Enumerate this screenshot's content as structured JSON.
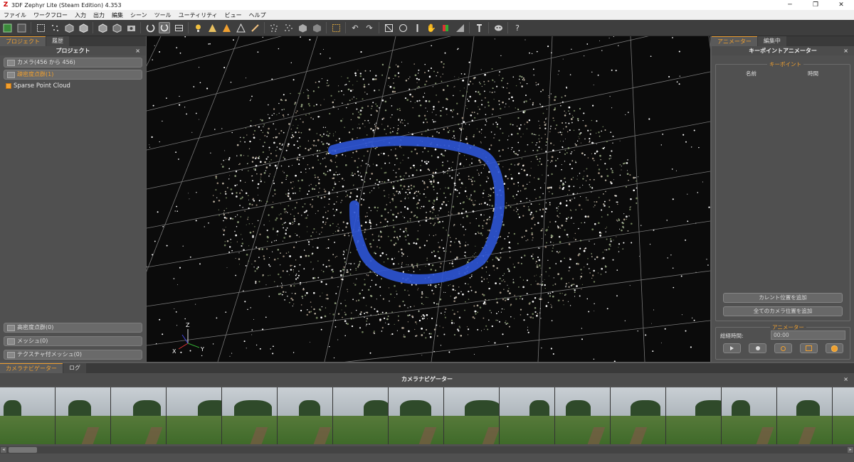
{
  "window": {
    "title": "3DF Zephyr Lite (Steam Edition) 4.353",
    "minimize_glyph": "─",
    "maximize_glyph": "❐",
    "close_glyph": "✕"
  },
  "menu": [
    "ファイル",
    "ワークフロー",
    "入力",
    "出力",
    "編集",
    "シーン",
    "ツール",
    "ユーティリティ",
    "ビュー",
    "ヘルプ"
  ],
  "toolbar": {
    "icons": [
      "import-icon",
      "save-icon",
      "select-rect-icon",
      "select-points-icon",
      "cube-icon",
      "cube-icon",
      "cube-icon",
      "cube-icon",
      "cube-icon",
      "camera-icon",
      "rotate-icon",
      "orbit-icon",
      "frame-icon",
      "light-icon",
      "mesh-triangle-icon",
      "mesh-triangle-icon",
      "mesh-triangle-icon",
      "brush-icon",
      "points-icon",
      "points-icon",
      "cube-icon",
      "cube-icon",
      "bounding-box-icon",
      "undo-icon",
      "redo-icon",
      "transform-icon",
      "circle-icon",
      "measure-icon",
      "hand-icon",
      "color-icon",
      "ruler-icon",
      "tool-icon",
      "mask-icon",
      "help-icon"
    ],
    "help_label": "?"
  },
  "left_panel": {
    "tabs": [
      "プロジェクト",
      "履歴"
    ],
    "header": "プロジェクト",
    "close": "×",
    "cameras": "カメラ(456 から 456)",
    "sparse_group": "疎密度点群(1)",
    "sparse_item": "Sparse Point Cloud",
    "dense_group": "高密度点群(0)",
    "mesh_group": "メッシュ(0)",
    "textured_group": "テクスチャ付メッシュ(0)"
  },
  "viewport": {
    "axis_labels": {
      "z": "Z",
      "x": "X",
      "y": "Y"
    }
  },
  "right_panel": {
    "tabs": [
      "アニメーター",
      "編集中"
    ],
    "header": "キーポイントアニメーター",
    "close": "×",
    "keypoint_box_label": "キーポイント",
    "col_name": "名前",
    "col_time": "時間",
    "add_current": "カレント位置を追加",
    "add_all_cameras": "全てのカメラ位置を追加",
    "animator_box_label": "アニメーター",
    "total_time_label": "総経時間:",
    "total_time_value": "00:00"
  },
  "bottom": {
    "tabs": [
      "カメラナビゲーター",
      "ログ"
    ],
    "header": "カメラナビゲーター",
    "close": "×"
  },
  "colors": {
    "accent": "#f0a030",
    "panel": "#505050",
    "viewport_bg": "#0b0b0b",
    "camera_path": "#2d55d6"
  }
}
